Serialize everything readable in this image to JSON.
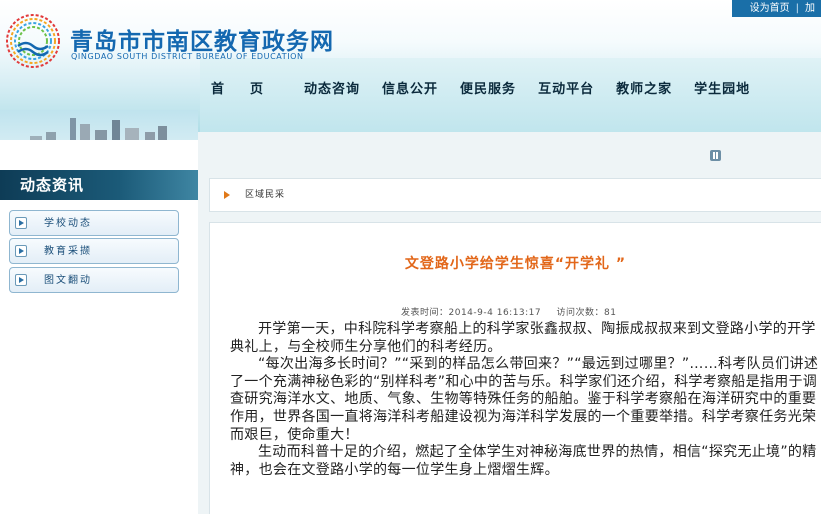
{
  "header": {
    "site_title": "青岛市市南区教育政务网",
    "site_subtitle": "QINGDAO SOUTH DISTRICT BUREAU OF EDUCATION",
    "top_links": [
      "设为首页",
      "加"
    ]
  },
  "nav": {
    "items": [
      "首页",
      "动态咨询",
      "信息公开",
      "便民服务",
      "互动平台",
      "教师之家",
      "学生园地"
    ]
  },
  "sidebar": {
    "section_title": "动态资讯",
    "items": [
      {
        "label": "学校动态"
      },
      {
        "label": "教育采撷"
      },
      {
        "label": "图文翻动"
      }
    ]
  },
  "breadcrumb": {
    "label": "区域民采"
  },
  "article": {
    "title": "文登路小学给学生惊喜“开学礼 ”",
    "publish_time_label": "发表时间：2014-9-4 16:13:17",
    "visits_label": "访问次数：81",
    "paragraphs": [
      "开学第一天，中科院科学考察船上的科学家张鑫叔叔、陶振成叔叔来到文登路小学的开学典礼上，与全校师生分享他们的科考经历。",
      "“每次出海多长时间？”“采到的样品怎么带回来？”“最远到过哪里？”……科考队员们讲述了一个充满神秘色彩的“别样科考”和心中的苦与乐。科学家们还介绍，科学考察船是指用于调查研究海洋水文、地质、气象、生物等特殊任务的船舶。鉴于科学考察船在海洋研究中的重要作用，世界各国一直将海洋科考船建设视为海洋科学发展的一个重要举措。科学考察任务光荣而艰巨，使命重大！",
      "生动而科普十足的介绍，燃起了全体学生对神秘海底世界的热情，相信“探究无止境”的精神，也会在文登路小学的每一位学生身上熠熠生辉。"
    ]
  },
  "colors": {
    "brand_blue": "#1468b0",
    "article_title_orange": "#e2671a",
    "section_title_bg": "#0e3c56"
  }
}
